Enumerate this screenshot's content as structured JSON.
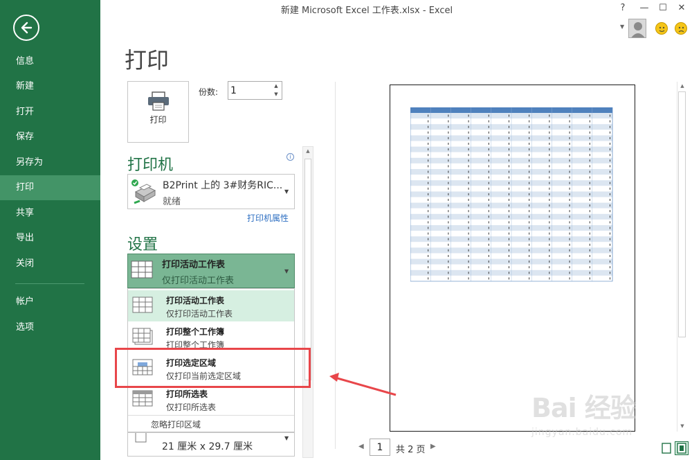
{
  "window": {
    "title": "新建 Microsoft Excel 工作表.xlsx - Excel",
    "help": "?",
    "minimize": "—",
    "maximize": "☐",
    "close": "✕"
  },
  "sidebar": {
    "items": [
      {
        "label": "信息"
      },
      {
        "label": "新建"
      },
      {
        "label": "打开"
      },
      {
        "label": "保存"
      },
      {
        "label": "另存为"
      },
      {
        "label": "打印",
        "active": true
      },
      {
        "label": "共享"
      },
      {
        "label": "导出"
      },
      {
        "label": "关闭"
      },
      {
        "label": "帐户"
      },
      {
        "label": "选项"
      }
    ]
  },
  "page_title": "打印",
  "print_button_label": "打印",
  "copies": {
    "label": "份数:",
    "value": "1"
  },
  "printer": {
    "section_title": "打印机",
    "name": "B2Print 上的 3#财务RIC...",
    "status": "就绪",
    "properties_link": "打印机属性"
  },
  "settings": {
    "section_title": "设置",
    "scope": {
      "title": "打印活动工作表",
      "subtitle": "仅打印活动工作表"
    },
    "menu": [
      {
        "title": "打印活动工作表",
        "subtitle": "仅打印活动工作表",
        "selected": true
      },
      {
        "title": "打印整个工作簿",
        "subtitle": "打印整个工作簿"
      },
      {
        "title": "打印选定区域",
        "subtitle": "仅打印当前选定区域"
      },
      {
        "title": "打印所选表",
        "subtitle": "仅打印所选表"
      }
    ],
    "ignore_print_area": "忽略打印区域",
    "paper_size": "21 厘米 x 29.7 厘米"
  },
  "pager": {
    "current": "1",
    "total": "共 2 页"
  },
  "watermark": {
    "brand": "Bai 经验",
    "url": "jingyan.baidu.com"
  },
  "colors": {
    "accent": "#217346",
    "active_nav": "#439467",
    "highlight": "#e8464a"
  }
}
